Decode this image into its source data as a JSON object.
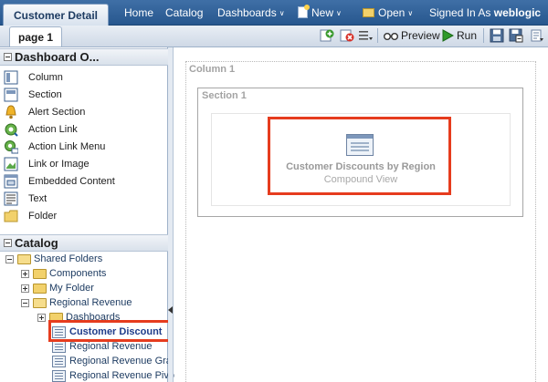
{
  "header": {
    "title": "Customer Detail",
    "nav": {
      "home": "Home",
      "catalog": "Catalog",
      "dashboards": "Dashboards",
      "new": "New",
      "open": "Open",
      "signed_in_as": "Signed In As",
      "user": "weblogic"
    }
  },
  "toolbar": {
    "page_tab": "page 1",
    "preview": "Preview",
    "run": "Run"
  },
  "dashboard_objects": {
    "heading": "Dashboard O...",
    "items": [
      {
        "label": "Column",
        "icon": "column-icon"
      },
      {
        "label": "Section",
        "icon": "section-icon"
      },
      {
        "label": "Alert Section",
        "icon": "alert-bell-icon"
      },
      {
        "label": "Action Link",
        "icon": "action-link-icon"
      },
      {
        "label": "Action Link Menu",
        "icon": "action-link-menu-icon"
      },
      {
        "label": "Link or Image",
        "icon": "link-image-icon"
      },
      {
        "label": "Embedded Content",
        "icon": "embedded-content-icon"
      },
      {
        "label": "Text",
        "icon": "text-icon"
      },
      {
        "label": "Folder",
        "icon": "folder-icon"
      }
    ]
  },
  "catalog": {
    "heading": "Catalog",
    "tree": {
      "shared_folders": "Shared Folders",
      "components": "Components",
      "my_folder": "My Folder",
      "regional_revenue": "Regional Revenue",
      "dashboards": "Dashboards",
      "customer_discount": "Customer Discount",
      "regional_revenue_item": "Regional Revenue",
      "regional_revenue_gra": "Regional Revenue Gra",
      "regional_revenue_pivo": "Regional Revenue Pivo"
    }
  },
  "canvas": {
    "column_label": "Column 1",
    "section_label": "Section 1",
    "view_name": "Customer Discounts by Region",
    "view_type": "Compound View"
  },
  "colors": {
    "highlight": "#e63c1e",
    "header_blue": "#27578e"
  }
}
